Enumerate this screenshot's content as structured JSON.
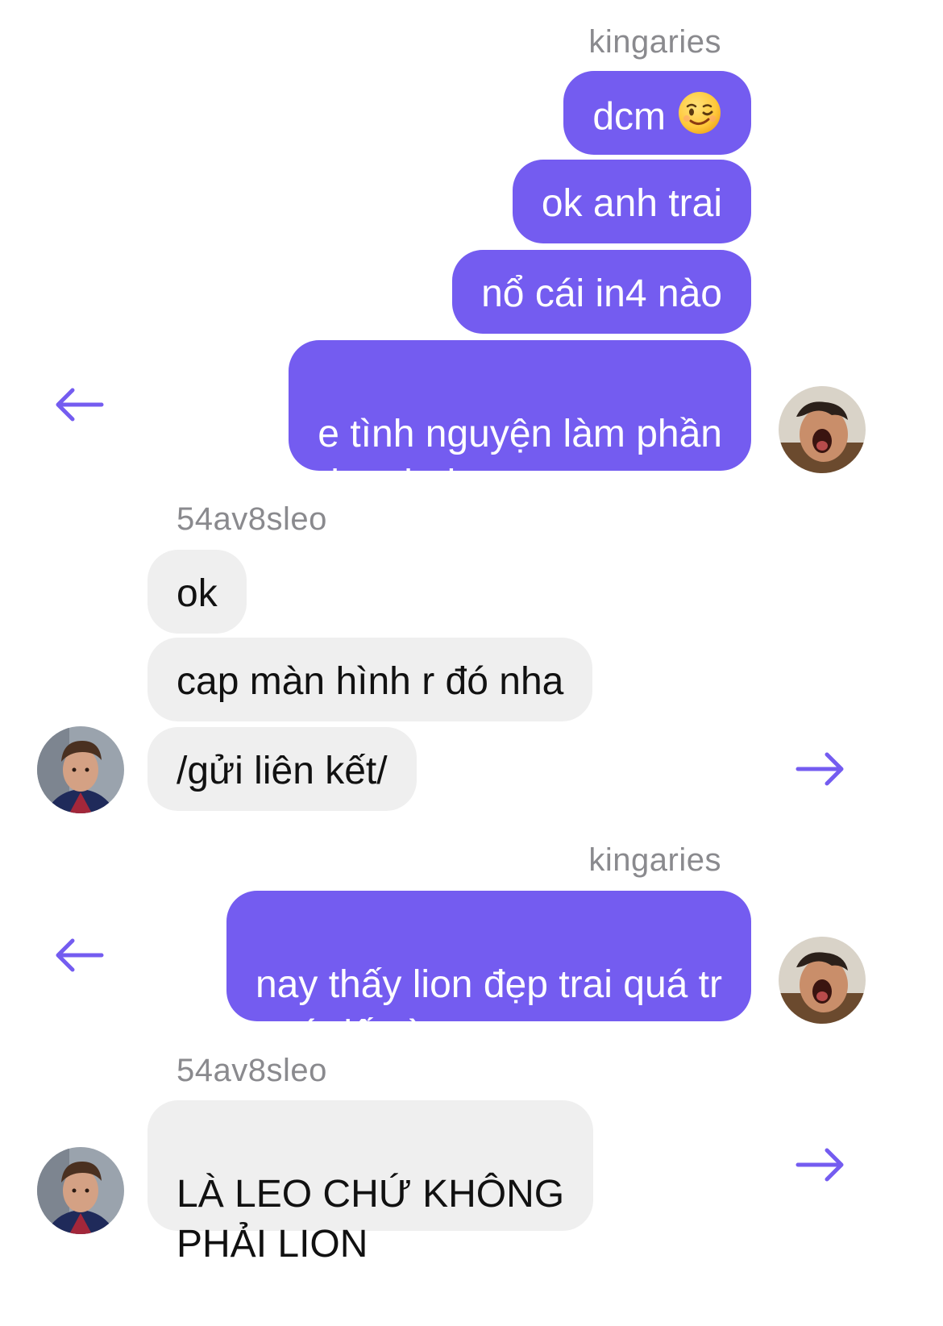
{
  "colors": {
    "accent": "#745cf0",
    "incoming_bubble": "#efefef",
    "sender_name": "#8a8a8e"
  },
  "groups": [
    {
      "sender": "kingaries",
      "direction": "outgoing",
      "messages": [
        "dcm",
        "ok anh trai",
        "nổ cái in4 nào",
        "e tình nguyện làm phần\ndoanh thu ạ"
      ],
      "reaction_emoji": "winking-face-emoji",
      "action_icon": "arrow-left-icon"
    },
    {
      "sender": "54av8sleo",
      "direction": "incoming",
      "messages": [
        "ok",
        "cap màn hình r đó nha",
        "/gửi liên kết/"
      ],
      "action_icon": "arrow-right-icon"
    },
    {
      "sender": "kingaries",
      "direction": "outgoing",
      "messages": [
        "nay thấy lion đẹp trai quá tr\nquá đấc àaa"
      ],
      "action_icon": "arrow-left-icon"
    },
    {
      "sender": "54av8sleo",
      "direction": "incoming",
      "messages": [
        "LÀ LEO CHỨ KHÔNG\nPHẢI LION"
      ],
      "action_icon": "arrow-right-icon"
    }
  ]
}
